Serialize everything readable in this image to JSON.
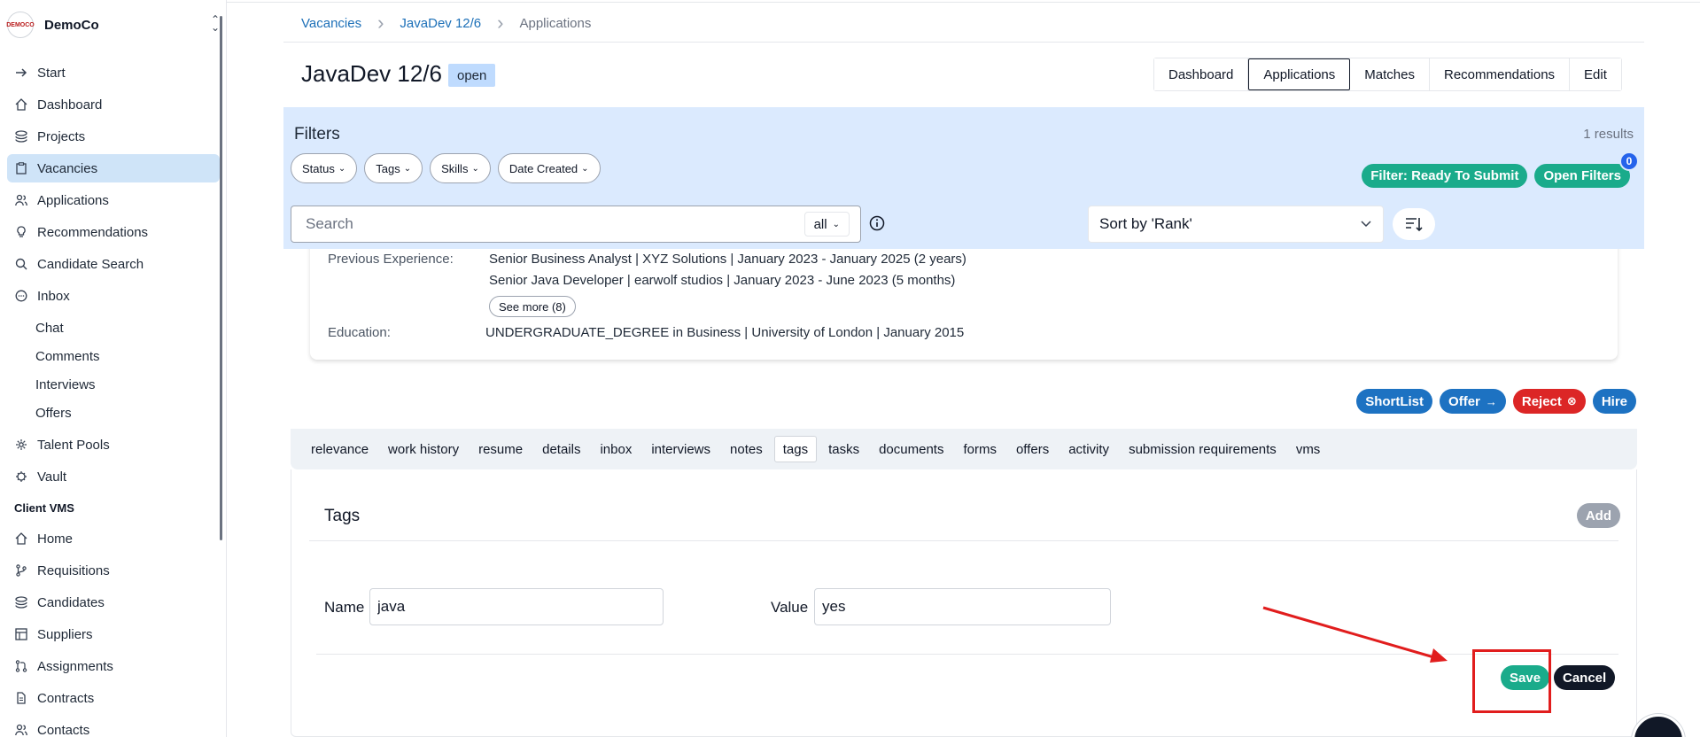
{
  "sidebar": {
    "brand": {
      "logo_text": "DEMOCO",
      "name": "DemoCo"
    },
    "items": [
      {
        "label": "Start",
        "icon": "arrow-right-icon"
      },
      {
        "label": "Dashboard",
        "icon": "home-icon"
      },
      {
        "label": "Projects",
        "icon": "layers-icon"
      },
      {
        "label": "Vacancies",
        "icon": "clipboard-icon",
        "active": true
      },
      {
        "label": "Applications",
        "icon": "users-icon"
      },
      {
        "label": "Recommendations",
        "icon": "lightbulb-icon"
      },
      {
        "label": "Candidate Search",
        "icon": "search-icon"
      },
      {
        "label": "Inbox",
        "icon": "message-icon"
      }
    ],
    "inbox_sub": [
      "Chat",
      "Comments",
      "Interviews",
      "Offers"
    ],
    "items2": [
      {
        "label": "Talent Pools",
        "icon": "pool-icon"
      },
      {
        "label": "Vault",
        "icon": "vault-icon"
      }
    ],
    "group_label": "Client VMS",
    "vms_items": [
      {
        "label": "Home",
        "icon": "home-icon"
      },
      {
        "label": "Requisitions",
        "icon": "git-branch-icon"
      },
      {
        "label": "Candidates",
        "icon": "layers-icon"
      },
      {
        "label": "Suppliers",
        "icon": "suppliers-icon"
      },
      {
        "label": "Assignments",
        "icon": "git-pull-icon"
      },
      {
        "label": "Contracts",
        "icon": "file-icon"
      },
      {
        "label": "Contacts",
        "icon": "users-icon"
      }
    ]
  },
  "breadcrumb": {
    "items": [
      "Vacancies",
      "JavaDev 12/6"
    ],
    "current": "Applications"
  },
  "header": {
    "title": "JavaDev 12/6",
    "status": "open",
    "tabs": [
      "Dashboard",
      "Applications",
      "Matches",
      "Recommendations",
      "Edit"
    ],
    "active_tab": "Applications"
  },
  "filters": {
    "title": "Filters",
    "results": "1 results",
    "chips": [
      "Status",
      "Tags",
      "Skills",
      "Date Created"
    ],
    "ready_btn": "Filter: Ready To Submit",
    "open_btn": "Open Filters",
    "open_count": "0",
    "search_placeholder": "Search",
    "scope": "all",
    "sort": "Sort by 'Rank'"
  },
  "card": {
    "prev_label": "Previous Experience:",
    "prev_items": [
      "Senior Business Analyst | XYZ Solutions | January 2023 - January 2025 (2 years)",
      "Senior Java Developer | earwolf studios | January 2023 - June 2023 (5 months)"
    ],
    "see_more": "See more (8)",
    "edu_label": "Education:",
    "edu_value": "UNDERGRADUATE_DEGREE in Business | University of London | January 2015"
  },
  "actions": [
    "ShortList",
    "Offer",
    "Reject",
    "Hire"
  ],
  "detail_tabs": [
    "relevance",
    "work history",
    "resume",
    "details",
    "inbox",
    "interviews",
    "notes",
    "tags",
    "tasks",
    "documents",
    "forms",
    "offers",
    "activity",
    "submission requirements",
    "vms"
  ],
  "active_detail_tab": "tags",
  "tags": {
    "title": "Tags",
    "add": "Add",
    "name_label": "Name",
    "name_value": "java",
    "value_label": "Value",
    "value_value": "yes",
    "save": "Save",
    "cancel": "Cancel"
  },
  "colors": {
    "accent_green": "#1aab8b",
    "accent_blue": "#1d72c2",
    "danger": "#dc2626",
    "annotation": "#e11d1d"
  }
}
